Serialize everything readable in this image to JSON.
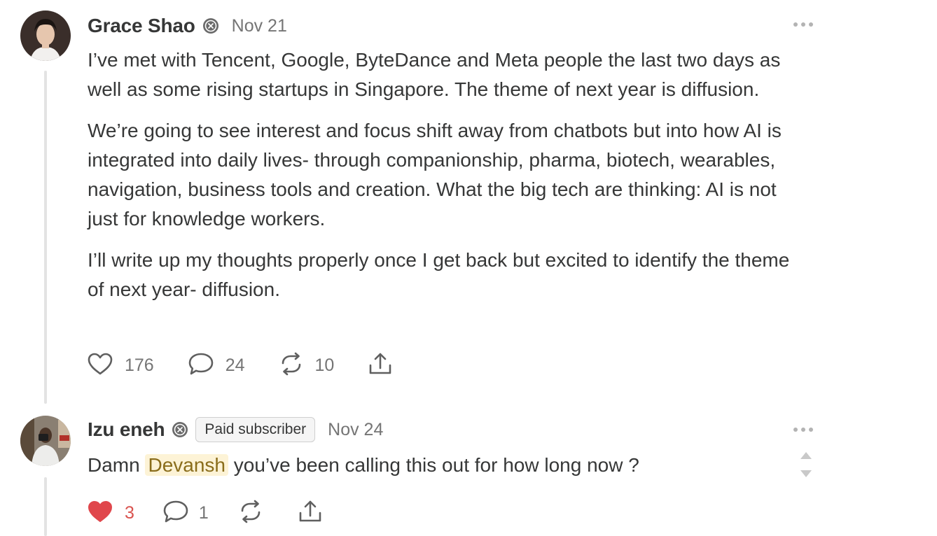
{
  "comments": [
    {
      "author": "Grace Shao",
      "author_badge_icon": "subscriber-badge-icon",
      "date": "Nov 21",
      "paragraphs": [
        "I’ve met with Tencent, Google, ByteDance and Meta people the last two days as well as some rising startups in Singapore. The theme of next year is diffusion.",
        "We’re going to see interest and focus shift away from chatbots but into how AI is integrated into daily lives- through companionship, pharma, biotech, wearables, navigation, business tools and creation. What the big tech are thinking: AI is not just for knowledge workers.",
        "I’ll write up my thoughts properly once I get back but excited to identify the theme of next year- diffusion."
      ],
      "likes": "176",
      "replies": "24",
      "restacks": "10",
      "liked": false
    },
    {
      "author": "Izu eneh",
      "author_badge_icon": "subscriber-badge-icon",
      "subscriber_label": "Paid subscriber",
      "date": "Nov 24",
      "text_before": "Damn ",
      "mention": "Devansh",
      "text_after": " you’ve been calling this out for how long now ?",
      "likes": "3",
      "replies": "1",
      "liked": true
    }
  ],
  "colors": {
    "text": "#363737",
    "muted": "#757575",
    "like_active": "#e0474c",
    "mention_bg": "#fdf3d6",
    "thread_line": "#e3e3e3"
  }
}
